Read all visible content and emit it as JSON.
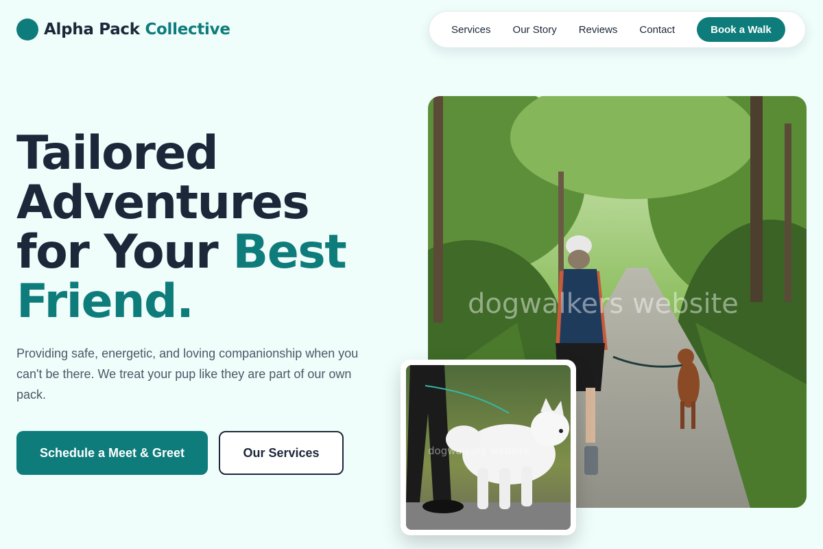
{
  "header": {
    "logo_part1": "Alpha Pack",
    "logo_part2": "Collective",
    "nav": [
      {
        "label": "Services"
      },
      {
        "label": "Our Story"
      },
      {
        "label": "Reviews"
      },
      {
        "label": "Contact"
      }
    ],
    "cta_label": "Book a Walk"
  },
  "hero": {
    "headline_line1": "Tailored",
    "headline_line2": "Adventures",
    "headline_line3a": "for Your",
    "headline_line3b": "Best",
    "headline_line4": "Friend.",
    "lead": "Providing safe, energetic, and loving companionship when you can't be there. We treat your pup like they are part of our own pack.",
    "primary_button": "Schedule a Meet & Greet",
    "secondary_button": "Our Services"
  },
  "images": {
    "main_watermark": "dogwalkers website",
    "card_watermark": "dogwalkers website"
  },
  "colors": {
    "accent": "#0e7c7b",
    "text": "#1c2739",
    "background": "#effdfb"
  }
}
